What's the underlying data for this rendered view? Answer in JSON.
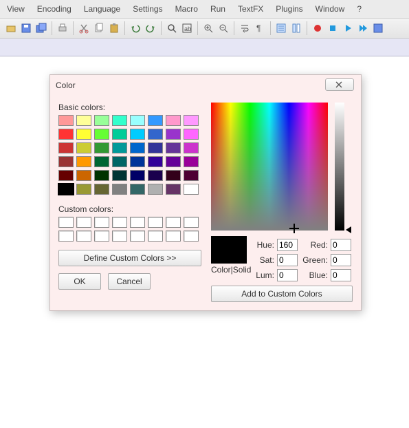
{
  "menu": [
    "View",
    "Encoding",
    "Language",
    "Settings",
    "Macro",
    "Run",
    "TextFX",
    "Plugins",
    "Window",
    "?"
  ],
  "dialog": {
    "title": "Color",
    "basic_label": "Basic colors:",
    "custom_label": "Custom colors:",
    "define_btn": "Define Custom Colors >>",
    "ok": "OK",
    "cancel": "Cancel",
    "solid_label": "Color|Solid",
    "add_btn": "Add to Custom Colors",
    "hue_label": "Hue:",
    "sat_label": "Sat:",
    "lum_label": "Lum:",
    "red_label": "Red:",
    "green_label": "Green:",
    "blue_label": "Blue:",
    "hue": "160",
    "sat": "0",
    "lum": "0",
    "red": "0",
    "green": "0",
    "blue": "0"
  },
  "basic_colors": [
    "#ff9999",
    "#ffff99",
    "#99ff99",
    "#33ffcc",
    "#99ffff",
    "#3399ff",
    "#ff99cc",
    "#ff99ff",
    "#ff3333",
    "#ffff33",
    "#66ff33",
    "#00cc99",
    "#00ccff",
    "#3366cc",
    "#9933cc",
    "#ff66ff",
    "#cc3333",
    "#cccc33",
    "#339933",
    "#009999",
    "#0066cc",
    "#333399",
    "#663399",
    "#cc33cc",
    "#993333",
    "#ff9900",
    "#006633",
    "#006666",
    "#003399",
    "#330099",
    "#660099",
    "#990099",
    "#660000",
    "#cc6600",
    "#003300",
    "#003333",
    "#000066",
    "#1a004d",
    "#33001a",
    "#4d0033",
    "#000000",
    "#999933",
    "#666633",
    "#808080",
    "#336666",
    "#b0b0b0",
    "#663366",
    "#ffffff"
  ]
}
